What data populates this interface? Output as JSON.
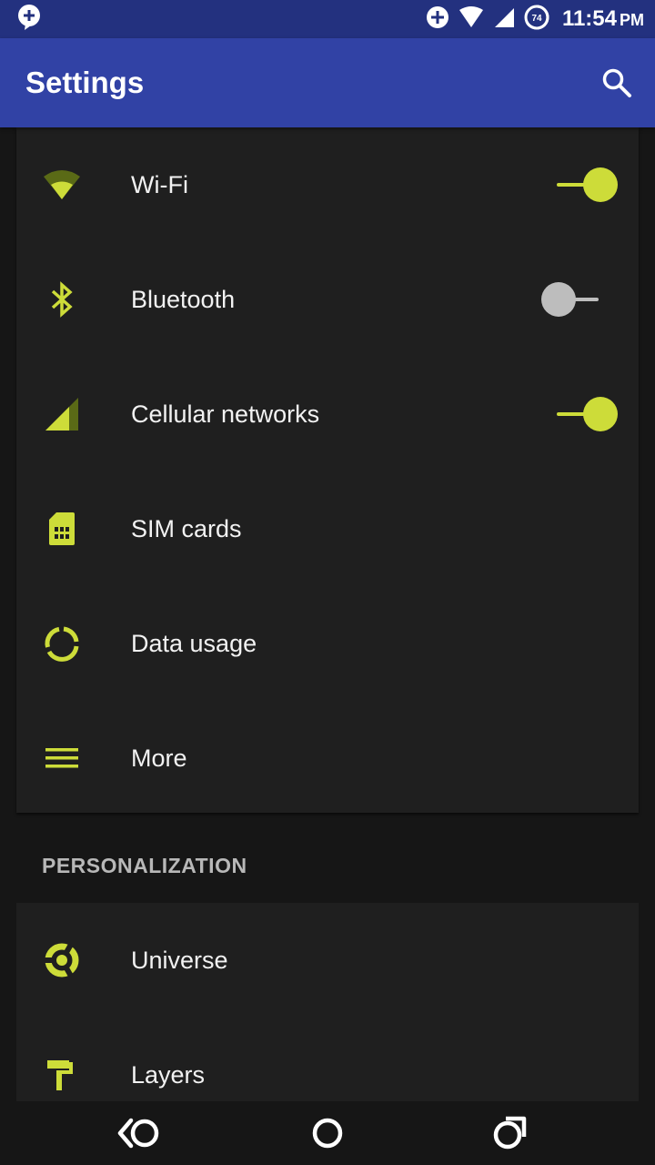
{
  "status_bar": {
    "time": "11:54",
    "ampm": "PM",
    "battery_level": "74"
  },
  "app_bar": {
    "title": "Settings"
  },
  "wireless": [
    {
      "label": "Wi-Fi",
      "icon": "wifi-icon",
      "toggle": true
    },
    {
      "label": "Bluetooth",
      "icon": "bluetooth-icon",
      "toggle": false
    },
    {
      "label": "Cellular networks",
      "icon": "cellular-icon",
      "toggle": true
    },
    {
      "label": "SIM cards",
      "icon": "sim-card-icon"
    },
    {
      "label": "Data usage",
      "icon": "data-usage-icon"
    },
    {
      "label": "More",
      "icon": "more-icon"
    }
  ],
  "personalization": {
    "header": "PERSONALIZATION",
    "items": [
      {
        "label": "Universe",
        "icon": "universe-icon"
      },
      {
        "label": "Layers",
        "icon": "layers-icon"
      }
    ]
  },
  "colors": {
    "accent": "#cddc39",
    "app_bar": "#3142a5",
    "status_bar": "#23317f",
    "card": "#1f1f1f",
    "background": "#161616"
  }
}
